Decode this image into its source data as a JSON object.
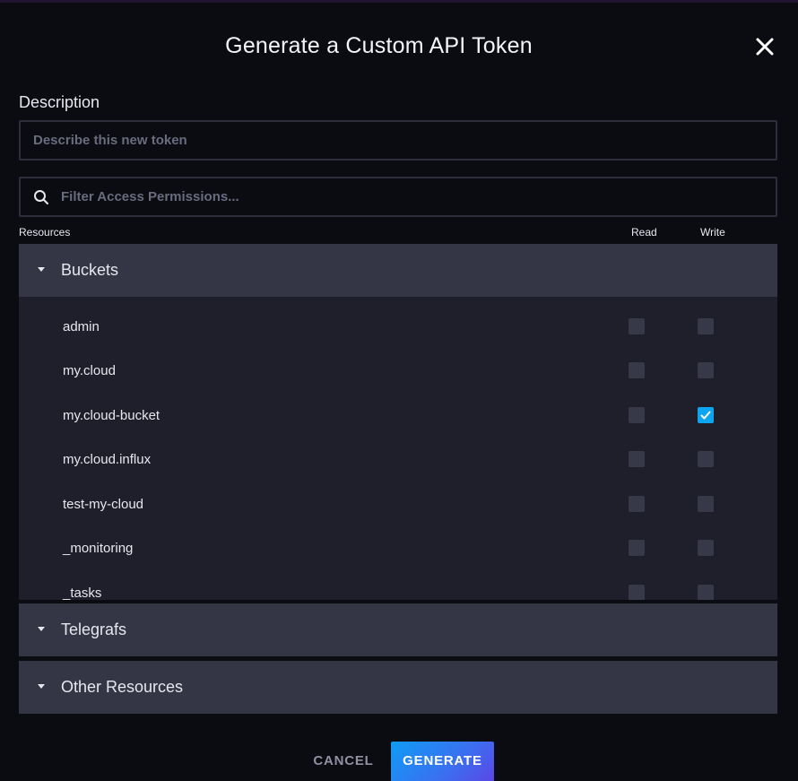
{
  "dialog": {
    "title": "Generate a Custom API Token",
    "close_icon": "close-icon"
  },
  "description": {
    "label": "Description",
    "placeholder": "Describe this new token",
    "value": ""
  },
  "filter": {
    "icon": "search-icon",
    "placeholder": "Filter Access Permissions...",
    "value": ""
  },
  "columns": {
    "resources": "Resources",
    "read": "Read",
    "write": "Write"
  },
  "sections": [
    {
      "label": "Buckets",
      "expanded": true,
      "items": [
        {
          "name": "admin",
          "read": false,
          "write": false
        },
        {
          "name": "my.cloud",
          "read": false,
          "write": false
        },
        {
          "name": "my.cloud-bucket",
          "read": false,
          "write": true
        },
        {
          "name": "my.cloud.influx",
          "read": false,
          "write": false
        },
        {
          "name": "test-my-cloud",
          "read": false,
          "write": false
        },
        {
          "name": "_monitoring",
          "read": false,
          "write": false
        },
        {
          "name": "_tasks",
          "read": false,
          "write": false
        }
      ]
    },
    {
      "label": "Telegrafs",
      "expanded": false
    },
    {
      "label": "Other Resources",
      "expanded": false
    }
  ],
  "actions": {
    "cancel_label": "CANCEL",
    "generate_label": "GENERATE"
  },
  "colors": {
    "background": "#0b0b12",
    "section_header": "#343545",
    "list_background": "#1e1f2b",
    "checkbox_checked": "#0ea5f0",
    "checkbox_unchecked": "#383948"
  }
}
